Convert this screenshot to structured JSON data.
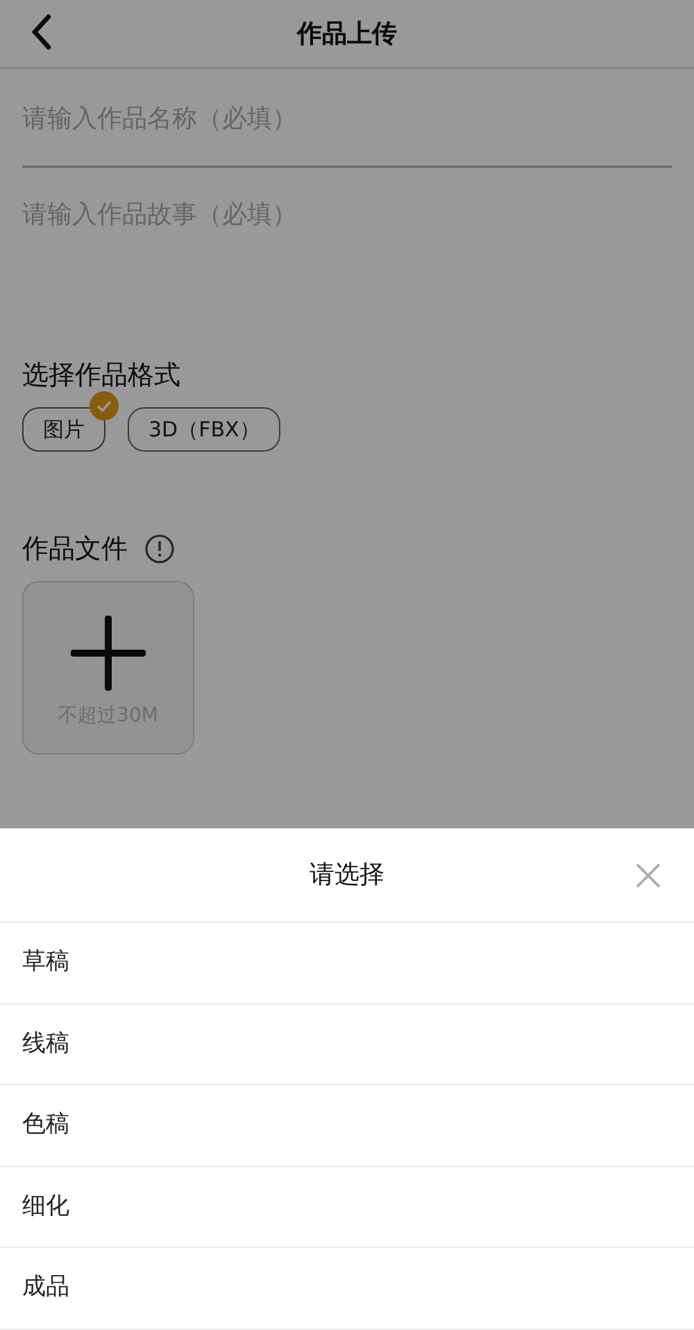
{
  "header": {
    "title": "作品上传"
  },
  "fields": [
    {
      "placeholder": "请输入作品名称（必填）"
    },
    {
      "placeholder": "请输入作品故事（必填）"
    }
  ],
  "format": {
    "label": "选择作品格式",
    "options": [
      {
        "label": "图片",
        "selected": true
      },
      {
        "label": "3D（FBX）",
        "selected": false
      }
    ]
  },
  "file": {
    "label": "作品文件",
    "upload_hint": "不超过30M"
  },
  "sheet": {
    "title": "请选择",
    "options": [
      "草稿",
      "线稿",
      "色稿",
      "细化",
      "成品"
    ]
  }
}
